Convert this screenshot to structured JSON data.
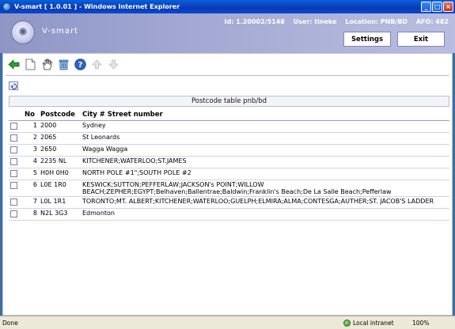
{
  "window": {
    "title": "V-smart [ 1.0.01 ] - Windows Internet Explorer",
    "controls": [
      "_",
      "□",
      "×"
    ]
  },
  "header": {
    "brand": "V-smart",
    "id_text": "Id: 1.20002/5148",
    "user_text": "User: tineke",
    "location_text": "Location: PNB/BD",
    "afo_text": "AFO: 482",
    "settings_label": "Settings",
    "exit_label": "Exit"
  },
  "toolbar": {
    "icons": [
      "back-arrow-icon",
      "new-document-icon",
      "hand-select-icon",
      "trash-icon",
      "help-icon",
      "up-arrow-icon",
      "down-arrow-icon"
    ]
  },
  "table": {
    "title": "Postcode table pnb/bd",
    "columns": [
      "No",
      "Postcode",
      "City # Street number"
    ],
    "rows": [
      {
        "no": "1",
        "postcode": "2000",
        "city": "Sydney"
      },
      {
        "no": "2",
        "postcode": "2065",
        "city": "St Leonards"
      },
      {
        "no": "3",
        "postcode": "2650",
        "city": "Wagga Wagga"
      },
      {
        "no": "4",
        "postcode": "2235 NL",
        "city": "KITCHENER;WATERLOO;ST.JAMES"
      },
      {
        "no": "5",
        "postcode": "H0H 0H0",
        "city": "NORTH POLE #1\";SOUTH POLE #2"
      },
      {
        "no": "6",
        "postcode": "L0E 1R0",
        "city": "KESWICK;SUTTON;PEFFERLAW;JACKSON's POINT;WILLOW BEACH;ZEPHER;EGYPT;Belhaven;Ballentrae;Baldwin;Franklin's Beach;De La Salle Beach;Pefferlaw"
      },
      {
        "no": "7",
        "postcode": "L0L 1R1",
        "city": "TORONTO;MT. ALBERT;KITCHENER;WATERLOO;GUELPH;ELMIRA;ALMA;CONTESGA;AUTHER;ST. JACOB'S LADDER"
      },
      {
        "no": "8",
        "postcode": "N2L 3G3",
        "city": "Edmonton"
      }
    ]
  },
  "statusbar": {
    "status": "Done",
    "zone": "Local intranet",
    "zoom": "100%"
  }
}
